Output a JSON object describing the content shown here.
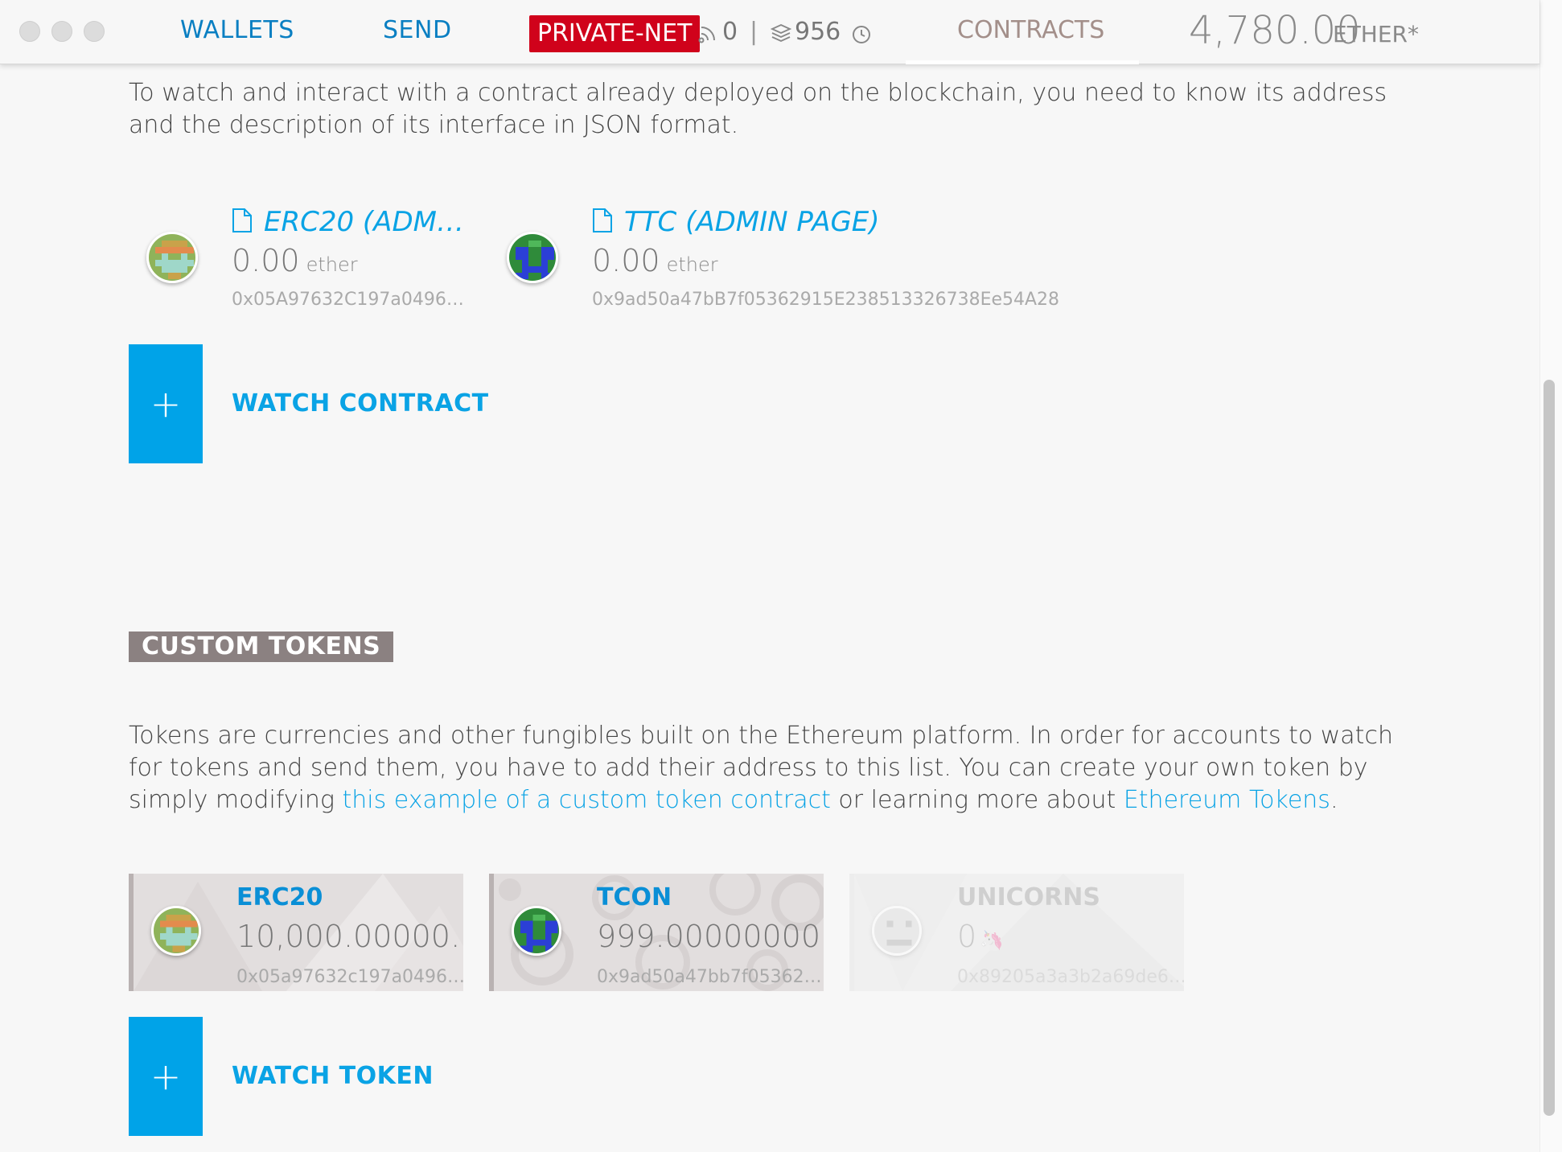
{
  "header": {
    "nav": [
      "WALLETS",
      "SEND"
    ],
    "network_badge": "PRIVATE-NET",
    "peers": "0",
    "separator": "|",
    "block": "956",
    "active_tab": "CONTRACTS",
    "balance_amount": "4,780.00",
    "balance_unit": "ETHER*"
  },
  "contracts": {
    "intro": "To watch and interact with a contract already deployed on the blockchain, you need to know its address and the description of its interface in JSON format.",
    "items": [
      {
        "name": "ERC20 (ADM…",
        "amount": "0.00",
        "unit": "ether",
        "address": "0x05A97632C197a0496…"
      },
      {
        "name": "TTC (ADMIN PAGE)",
        "amount": "0.00",
        "unit": "ether",
        "address": "0x9ad50a47bB7f05362915E238513326738Ee54A28"
      }
    ],
    "watch_label": "WATCH CONTRACT",
    "plus": "+"
  },
  "tokens": {
    "heading": "CUSTOM TOKENS",
    "desc_before": "Tokens are currencies and other fungibles built on the Ethereum platform. In order for accounts to watch for tokens and send them, you have to add their address to this list. You can create your own token by simply modifying ",
    "link1": "this example of a custom token contract",
    "desc_middle": " or learning more about ",
    "link2": "Ethereum Tokens",
    "desc_after": ".",
    "items": [
      {
        "name": "ERC20",
        "amount": "10,000.00000…",
        "address": "0x05a97632c197a0496…"
      },
      {
        "name": "TCON",
        "amount": "999.00000000…",
        "address": "0x9ad50a47bb7f05362…"
      },
      {
        "name": "UNICORNS",
        "amount": "0",
        "symbol": "🦄",
        "address": "0x89205a3a3b2a69de6…"
      }
    ],
    "watch_label": "WATCH TOKEN",
    "plus": "+"
  }
}
